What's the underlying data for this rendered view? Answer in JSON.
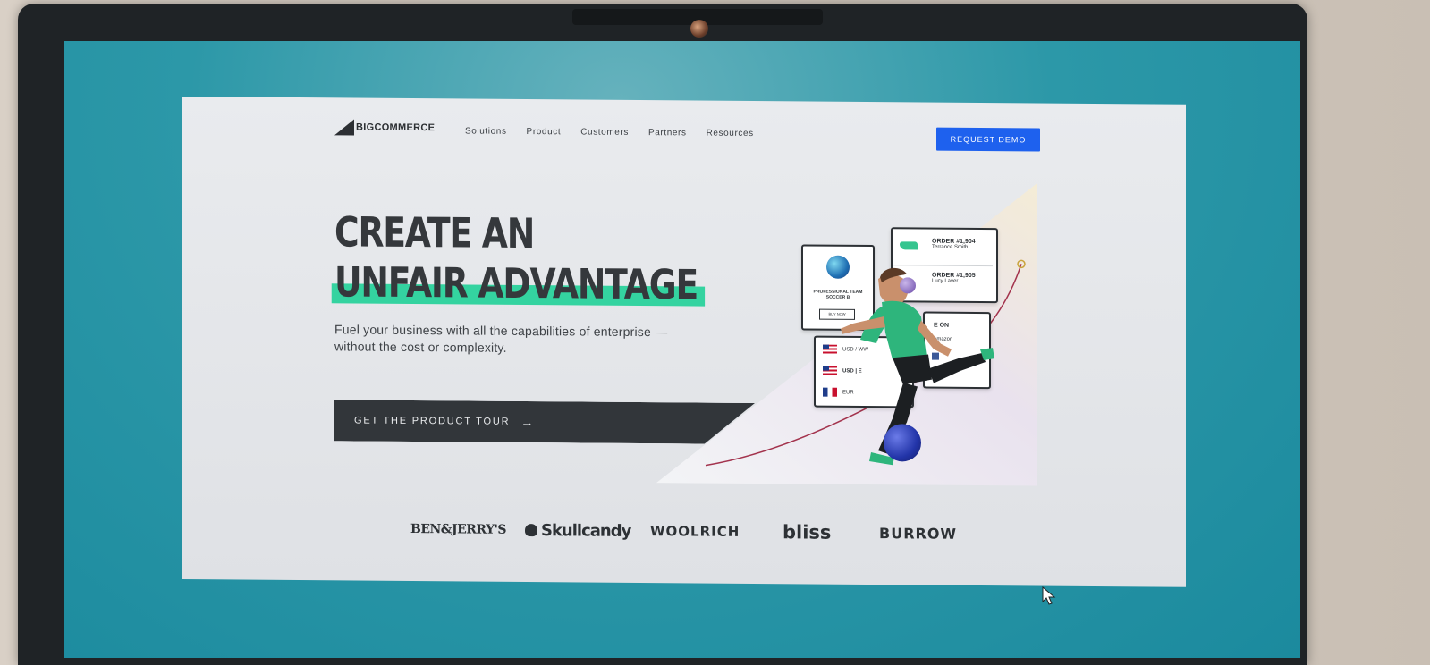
{
  "nav": {
    "logo_text": "BIGCOMMERCE",
    "items": [
      {
        "label": "Solutions"
      },
      {
        "label": "Product"
      },
      {
        "label": "Customers"
      },
      {
        "label": "Partners"
      },
      {
        "label": "Resources"
      }
    ],
    "cta_label": "REQUEST DEMO"
  },
  "hero": {
    "title_line1": "CREATE AN",
    "title_line2": "UNFAIR ADVANTAGE",
    "subtitle": "Fuel your business with all the capabilities of enterprise —without the cost or complexity.",
    "cta_label": "GET THE PRODUCT TOUR",
    "cta_arrow": "→"
  },
  "graphic": {
    "product_card": {
      "title": "PROFESSIONAL TEAM SOCCER B",
      "button": "BUY NOW"
    },
    "orders": [
      {
        "title": "ORDER #1,904",
        "name": "Terrance Smith"
      },
      {
        "title": "ORDER #1,905",
        "name": "Lucy Laver"
      }
    ],
    "currencies": [
      "USD / WW",
      "USD | E",
      "EUR"
    ],
    "channels_title": "E ON",
    "channels_item": "amazon"
  },
  "brands": [
    "BEN&JERRY'S",
    "Skullcandy",
    "WOOLRICH",
    "bliss",
    "BURROW"
  ],
  "colors": {
    "accent_blue": "#1e61ee",
    "highlight_green": "#34d3a0",
    "dark": "#32363a"
  }
}
